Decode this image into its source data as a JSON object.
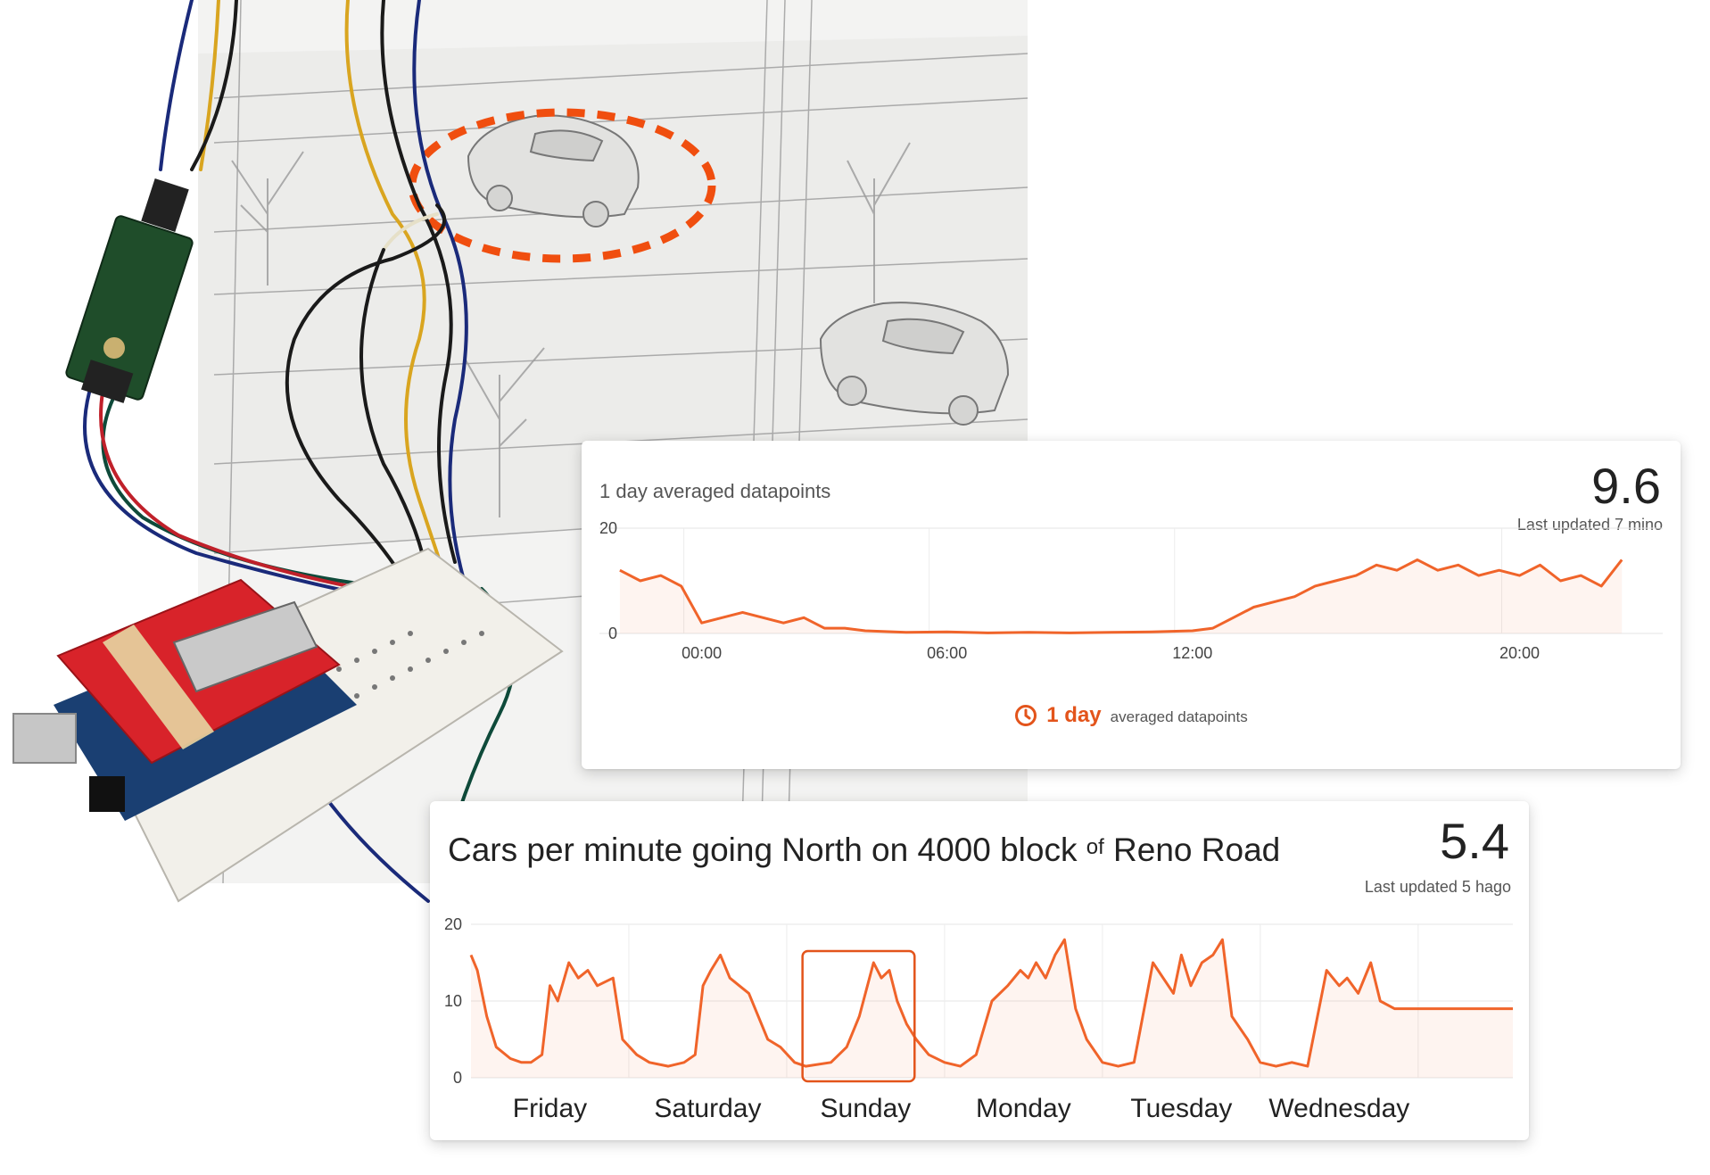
{
  "colors": {
    "accent": "#f0642a",
    "highlight": "#e3541b",
    "marker": "#f04e0f",
    "breadboard": "#f2f0ea",
    "shield": "#d8232a",
    "sensor": "#1f4d2a"
  },
  "icons": {
    "clock": "clock-icon"
  },
  "cards": {
    "day": {
      "subtitle": "1 day averaged datapoints",
      "value": "9.6",
      "last_updated": "Last updated 7 mino",
      "range_value": "1 day",
      "range_label": "averaged datapoints"
    },
    "week": {
      "title_part1": "Cars per minute going North on 4000 block",
      "title_of": "of",
      "title_part2": "Reno Road",
      "value": "5.4",
      "last_updated": "Last updated 5 hago"
    }
  },
  "chart_data": [
    {
      "type": "area",
      "ylim": [
        0,
        20
      ],
      "y_ticks": [
        "20",
        "0"
      ],
      "x_ticks": [
        "00:00",
        "06:00",
        "12:00",
        "20:00"
      ],
      "x_hours": [
        -2,
        -1.5,
        -1,
        -0.5,
        0,
        0.5,
        1,
        1.5,
        2,
        2.5,
        3,
        3.5,
        4,
        5,
        6,
        7,
        8,
        9,
        10,
        11,
        12,
        12.5,
        13,
        13.5,
        14,
        14.5,
        15,
        15.5,
        16,
        16.5,
        17,
        17.5,
        18,
        18.5,
        19,
        19.5,
        20,
        20.5,
        21,
        21.5,
        22,
        22.5
      ],
      "values": [
        12,
        10,
        11,
        9,
        2,
        3,
        4,
        3,
        2,
        3,
        1,
        1,
        0.5,
        0.2,
        0.3,
        0.1,
        0.2,
        0.1,
        0.2,
        0.3,
        0.5,
        1,
        3,
        5,
        6,
        7,
        9,
        10,
        11,
        13,
        12,
        14,
        12,
        13,
        11,
        12,
        11,
        13,
        10,
        11,
        9,
        14
      ]
    },
    {
      "type": "area",
      "ylim": [
        0,
        20
      ],
      "y_ticks": [
        "20",
        "10",
        "0"
      ],
      "categories": [
        "Friday",
        "Saturday",
        "Sunday",
        "Monday",
        "Tuesday",
        "Wednesday"
      ],
      "x_days": [
        0,
        0.04,
        0.1,
        0.16,
        0.25,
        0.32,
        0.38,
        0.45,
        0.5,
        0.55,
        0.62,
        0.68,
        0.74,
        0.8,
        0.9,
        0.96,
        1.05,
        1.13,
        1.25,
        1.35,
        1.42,
        1.47,
        1.52,
        1.58,
        1.64,
        1.7,
        1.76,
        1.88,
        1.96,
        2.05,
        2.12,
        2.28,
        2.38,
        2.46,
        2.55,
        2.6,
        2.65,
        2.7,
        2.76,
        2.82,
        2.9,
        3.0,
        3.1,
        3.2,
        3.3,
        3.4,
        3.48,
        3.53,
        3.58,
        3.64,
        3.7,
        3.76,
        3.83,
        3.9,
        4.0,
        4.1,
        4.2,
        4.32,
        4.45,
        4.5,
        4.56,
        4.63,
        4.7,
        4.76,
        4.82,
        4.92,
        5.0,
        5.1,
        5.2,
        5.3,
        5.42,
        5.5,
        5.55,
        5.62,
        5.7,
        5.76,
        5.85,
        6.0,
        6.2,
        6.4,
        6.6
      ],
      "values": [
        16,
        14,
        8,
        4,
        2.5,
        2,
        2,
        3,
        12,
        10,
        15,
        13,
        14,
        12,
        13,
        5,
        3,
        2,
        1.5,
        2,
        3,
        12,
        14,
        16,
        13,
        12,
        11,
        5,
        4,
        2,
        1.5,
        2,
        4,
        8,
        15,
        13,
        14,
        10,
        7,
        5,
        3,
        2,
        1.5,
        3,
        10,
        12,
        14,
        13,
        15,
        13,
        16,
        18,
        9,
        5,
        2,
        1.5,
        2,
        15,
        11,
        16,
        12,
        15,
        16,
        18,
        8,
        5,
        2,
        1.5,
        2,
        1.5,
        14,
        12,
        13,
        11,
        15,
        10,
        9,
        9,
        9,
        9,
        9
      ]
    }
  ]
}
